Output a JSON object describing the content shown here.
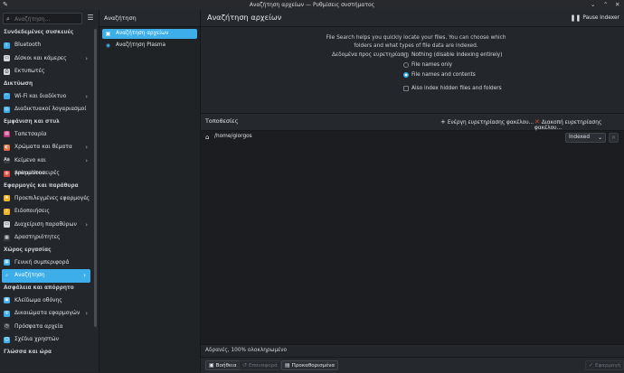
{
  "window": {
    "title": "Αναζήτηση αρχείων — Ρυθμίσεις συστήματος",
    "minimize": "⌄",
    "maximize": "⌃",
    "close": "✕"
  },
  "sidebar": {
    "search_placeholder": "Αναζήτηση...",
    "sections": [
      {
        "title": "Συνδεδεμένες συσκευές",
        "items": [
          {
            "label": "Bluetooth",
            "icon": "bluetooth-icon",
            "color": "#3daee9",
            "chev": false
          },
          {
            "label": "Δίσκοι και κάμερες",
            "icon": "drive-icon",
            "color": "#d5d7da",
            "chev": true
          },
          {
            "label": "Εκτυπωτές",
            "icon": "printer-icon",
            "color": "#d5d7da",
            "chev": false
          }
        ]
      },
      {
        "title": "Δικτύωση",
        "items": [
          {
            "label": "Wi-Fi και διαδίκτυο",
            "icon": "wifi-icon",
            "color": "#3daee9",
            "chev": true
          },
          {
            "label": "Διαδικτυακοί λογαριασμοί",
            "icon": "online-accounts-icon",
            "color": "#3daee9",
            "chev": false
          }
        ]
      },
      {
        "title": "Εμφάνιση και στυλ",
        "items": [
          {
            "label": "Ταπετσαρία",
            "icon": "wallpaper-icon",
            "color": "#c2357a",
            "chev": false
          },
          {
            "label": "Χρώματα και θέματα",
            "icon": "colors-icon",
            "color": "#e46b3b",
            "chev": true
          },
          {
            "label": "Κείμενο και γραμματοσειρές",
            "icon": "fonts-icon",
            "color": "#3a3d42",
            "chev": true
          },
          {
            "label": "Animations",
            "icon": "animations-icon",
            "color": "#e0483c",
            "chev": false
          }
        ]
      },
      {
        "title": "Εφαρμογές και παράθυρα",
        "items": [
          {
            "label": "Προεπιλεγμένες εφαρμογές",
            "icon": "star-icon",
            "color": "#f0b429",
            "chev": true
          },
          {
            "label": "Ειδοποιήσεις",
            "icon": "bell-icon",
            "color": "#f0b429",
            "chev": false
          },
          {
            "label": "Διαχείριση παραθύρων",
            "icon": "window-icon",
            "color": "#d5d7da",
            "chev": true
          },
          {
            "label": "Δραστηριότητες",
            "icon": "activities-icon",
            "color": "#3a3d42",
            "chev": false
          }
        ]
      },
      {
        "title": "Χώρος εργασίας",
        "items": [
          {
            "label": "Γενική συμπεριφορά",
            "icon": "general-icon",
            "color": "#3daee9",
            "chev": false
          },
          {
            "label": "Αναζήτηση",
            "icon": "search-icon",
            "color": "#3daee9",
            "chev": true,
            "selected": true
          }
        ]
      },
      {
        "title": "Ασφάλεια και απόρρητο",
        "items": [
          {
            "label": "Κλείδωμα οθόνης",
            "icon": "lock-icon",
            "color": "#3daee9",
            "chev": false
          },
          {
            "label": "Δικαιώματα εφαρμογών",
            "icon": "shield-icon",
            "color": "#3daee9",
            "chev": true
          },
          {
            "label": "Πρόσφατα αρχεία",
            "icon": "recent-icon",
            "color": "#3a3d42",
            "chev": false
          },
          {
            "label": "Σχέδια χρηστών",
            "icon": "users-icon",
            "color": "#3daee9",
            "chev": false
          }
        ]
      },
      {
        "title": "Γλώσσα και ώρα",
        "items": []
      }
    ]
  },
  "middle": {
    "header": "Αναζήτηση",
    "items": [
      {
        "label": "Αναζήτηση αρχείων",
        "selected": true
      },
      {
        "label": "Αναζήτηση Plasma",
        "selected": false
      }
    ]
  },
  "main": {
    "title": "Αναζήτηση αρχείων",
    "pause_label": "Pause Indexer",
    "description_1": "File Search helps you quickly locate your files. You can choose which",
    "description_2": "folders and what types of file data are indexed.",
    "data_label": "Δεδομένα προς ευρετηρίαση:",
    "options": [
      {
        "label": "Nothing (disable indexing entirely)",
        "checked": false
      },
      {
        "label": "File names only",
        "checked": false
      },
      {
        "label": "File names and contents",
        "checked": true
      }
    ],
    "hidden_label": "Also index hidden files and folders",
    "hidden_checked": false,
    "locations_title": "Τοποθεσίες",
    "enable_button": "Ενέργη ευρετηρίασης φακέλου...",
    "disable_button": "Διακοπή ευρετηρίασης φακέλου...",
    "locations": [
      {
        "path": "/home/giorgos",
        "state": "Indexed"
      }
    ],
    "status": "Αδρανές, 100% ολοκληρωμένο",
    "help_button": "Βοήθεια",
    "reset_button": "Επαναφορά",
    "defaults_button": "Προκαθορισμένα",
    "apply_button": "Εφαρμογή"
  }
}
